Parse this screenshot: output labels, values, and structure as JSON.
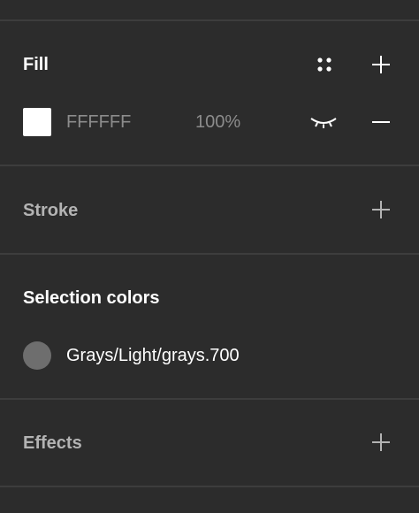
{
  "fill": {
    "title": "Fill",
    "hex_value": "FFFFFF",
    "opacity_value": "100%",
    "swatch_color": "#ffffff",
    "styles_icon": "four-dots-style-icon",
    "add_icon": "plus-icon",
    "visibility_icon": "eye-closed-icon",
    "remove_icon": "minus-icon"
  },
  "stroke": {
    "title": "Stroke",
    "add_icon": "plus-icon"
  },
  "selection_colors": {
    "title": "Selection colors",
    "items": [
      {
        "label": "Grays/Light/grays.700",
        "color": "#6e6e6e"
      }
    ]
  },
  "effects": {
    "title": "Effects",
    "add_icon": "plus-icon"
  },
  "colors": {
    "panel_bg": "#2c2c2c",
    "divider": "#3d3d3d",
    "text_primary": "#ffffff",
    "text_dim": "#b3b3b3",
    "text_value": "#8c8c8c"
  }
}
